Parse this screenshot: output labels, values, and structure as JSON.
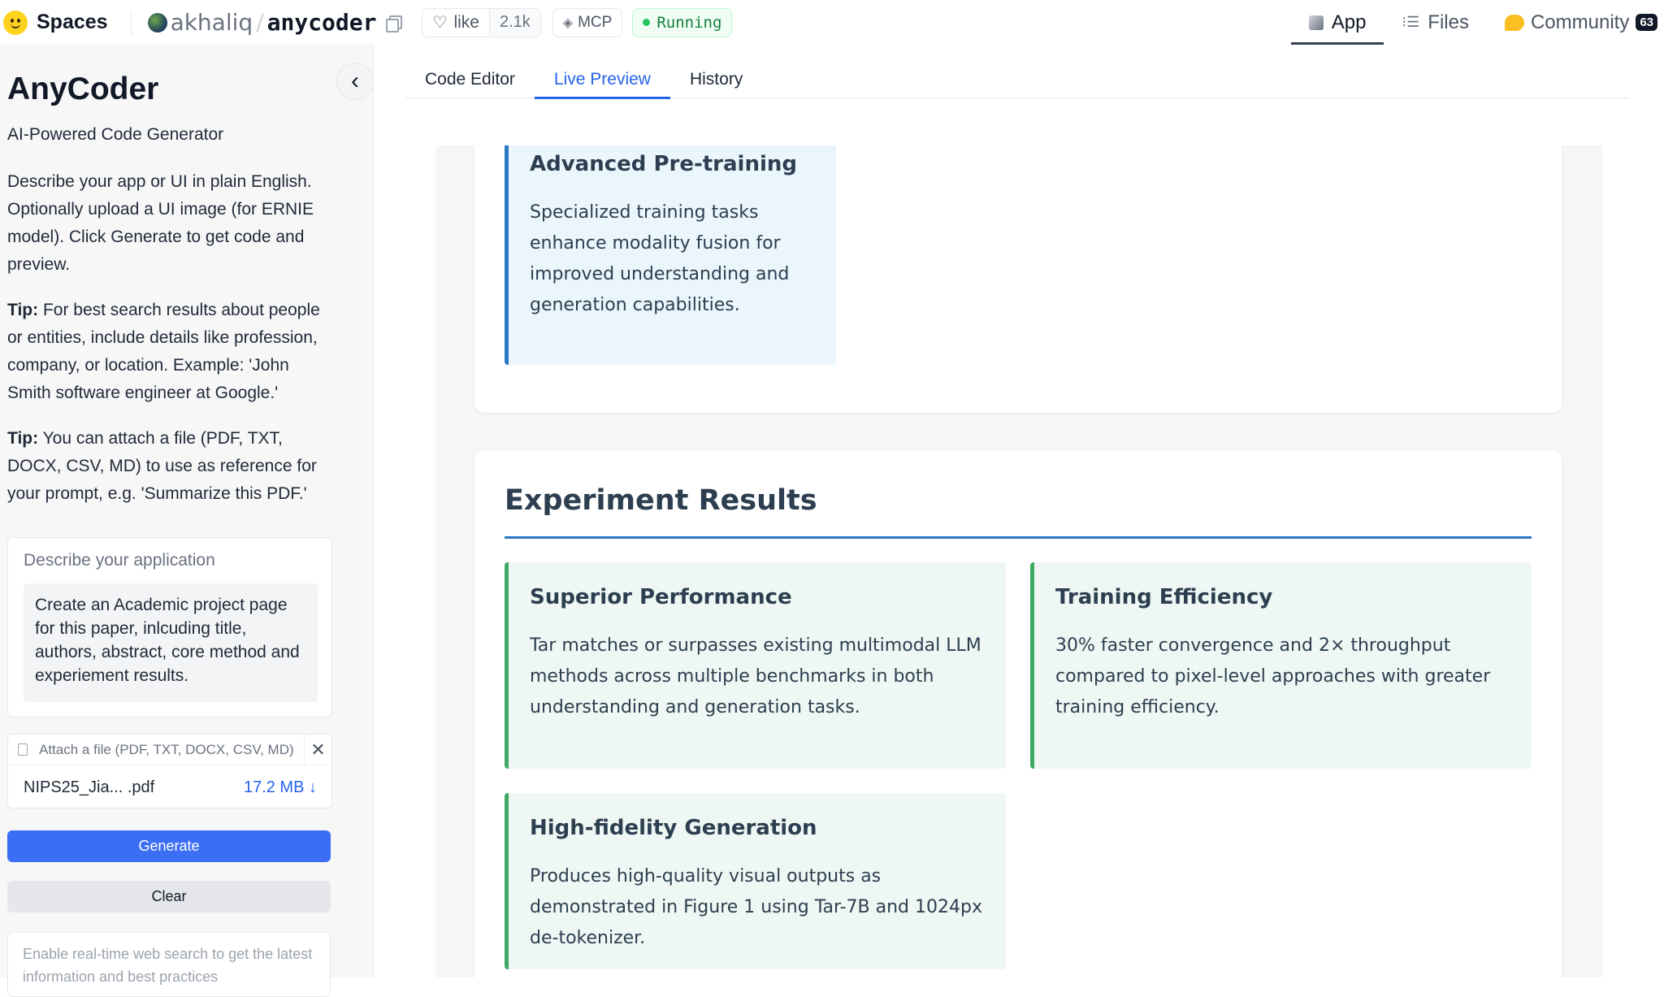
{
  "header": {
    "spaces_label": "Spaces",
    "user": "akhaliq",
    "slash": "/",
    "repo": "anycoder",
    "like_label": "like",
    "like_count": "2.1k",
    "mcp_label": "MCP",
    "status": "Running",
    "nav": [
      {
        "label": "App",
        "icon": "cube-icon",
        "active": true
      },
      {
        "label": "Files",
        "icon": "files-icon",
        "active": false
      },
      {
        "label": "Community",
        "icon": "community-icon",
        "active": false,
        "badge": "63"
      }
    ]
  },
  "sidebar": {
    "title": "AnyCoder",
    "subtitle": "AI-Powered Code Generator",
    "description": "Describe your app or UI in plain English. Optionally upload a UI image (for ERNIE model). Click Generate to get code and preview.",
    "tip1_label": "Tip:",
    "tip1_text": " For best search results about people or entities, include details like profession, company, or location. Example: 'John Smith software engineer at Google.'",
    "tip2_label": "Tip:",
    "tip2_text": " You can attach a file (PDF, TXT, DOCX, CSV, MD) to use as reference for your prompt, e.g. 'Summarize this PDF.'",
    "prompt_label": "Describe your application",
    "prompt_value": "Create an Academic project page for this paper, inlcuding title, authors, abstract, core method and experiement results.",
    "attach_label": "Attach a file (PDF, TXT, DOCX, CSV, MD)",
    "file_name": "NIPS25_Jia... .pdf",
    "file_size": "17.2 MB ↓",
    "generate_label": "Generate",
    "clear_label": "Clear",
    "search_placeholder": "Enable real-time web search to get the latest information and best practices"
  },
  "main": {
    "tabs": [
      {
        "label": "Code Editor",
        "active": false
      },
      {
        "label": "Live Preview",
        "active": true
      },
      {
        "label": "History",
        "active": false
      }
    ],
    "preview": {
      "pretraining": {
        "title": "Advanced Pre-training",
        "text": "Specialized training tasks enhance modality fusion for improved understanding and generation capabilities."
      },
      "results_title": "Experiment Results",
      "results": [
        {
          "title": "Superior Performance",
          "text": "Tar matches or surpasses existing multimodal LLM methods across multiple benchmarks in both understanding and generation tasks."
        },
        {
          "title": "Training Efficiency",
          "text": "30% faster convergence and 2× throughput compared to pixel-level approaches with greater training efficiency."
        },
        {
          "title": "High-fidelity Generation",
          "text": "Produces high-quality visual outputs as demonstrated in Figure 1 using Tar-7B and 1024px de-tokenizer."
        }
      ]
    }
  },
  "colors": {
    "accent": "#3b6ef5",
    "tab_active": "#2563eb",
    "blue_card_border": "#2b78c5",
    "green_card_border": "#3fa964",
    "running_green": "#22c55e"
  }
}
